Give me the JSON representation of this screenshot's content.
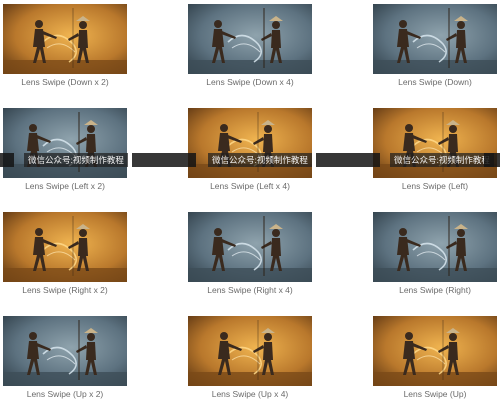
{
  "watermark": {
    "text": "微信公众号:视频制作教程"
  },
  "colors": {
    "warm_bg": "#b9782c",
    "warm_glow": "#f0b450",
    "cool_bg": "#5d7280",
    "cool_dark": "#2f3e48",
    "figure": "#3a2a1e",
    "label": "#6b6b6b"
  },
  "items": [
    {
      "label": "Lens Swipe (Down x 2)",
      "tone": "warm"
    },
    {
      "label": "Lens Swipe (Down x 4)",
      "tone": "cool"
    },
    {
      "label": "Lens Swipe (Down)",
      "tone": "cool"
    },
    {
      "label": "Lens Swipe (Left x 2)",
      "tone": "cool"
    },
    {
      "label": "Lens Swipe (Left x 4)",
      "tone": "warm"
    },
    {
      "label": "Lens Swipe (Left)",
      "tone": "warm"
    },
    {
      "label": "Lens Swipe (Right x 2)",
      "tone": "warm"
    },
    {
      "label": "Lens Swipe (Right x 4)",
      "tone": "cool"
    },
    {
      "label": "Lens Swipe (Right)",
      "tone": "cool"
    },
    {
      "label": "Lens Swipe (Up x 2)",
      "tone": "cool"
    },
    {
      "label": "Lens Swipe (Up x 4)",
      "tone": "warm"
    },
    {
      "label": "Lens Swipe (Up)",
      "tone": "warm"
    }
  ]
}
